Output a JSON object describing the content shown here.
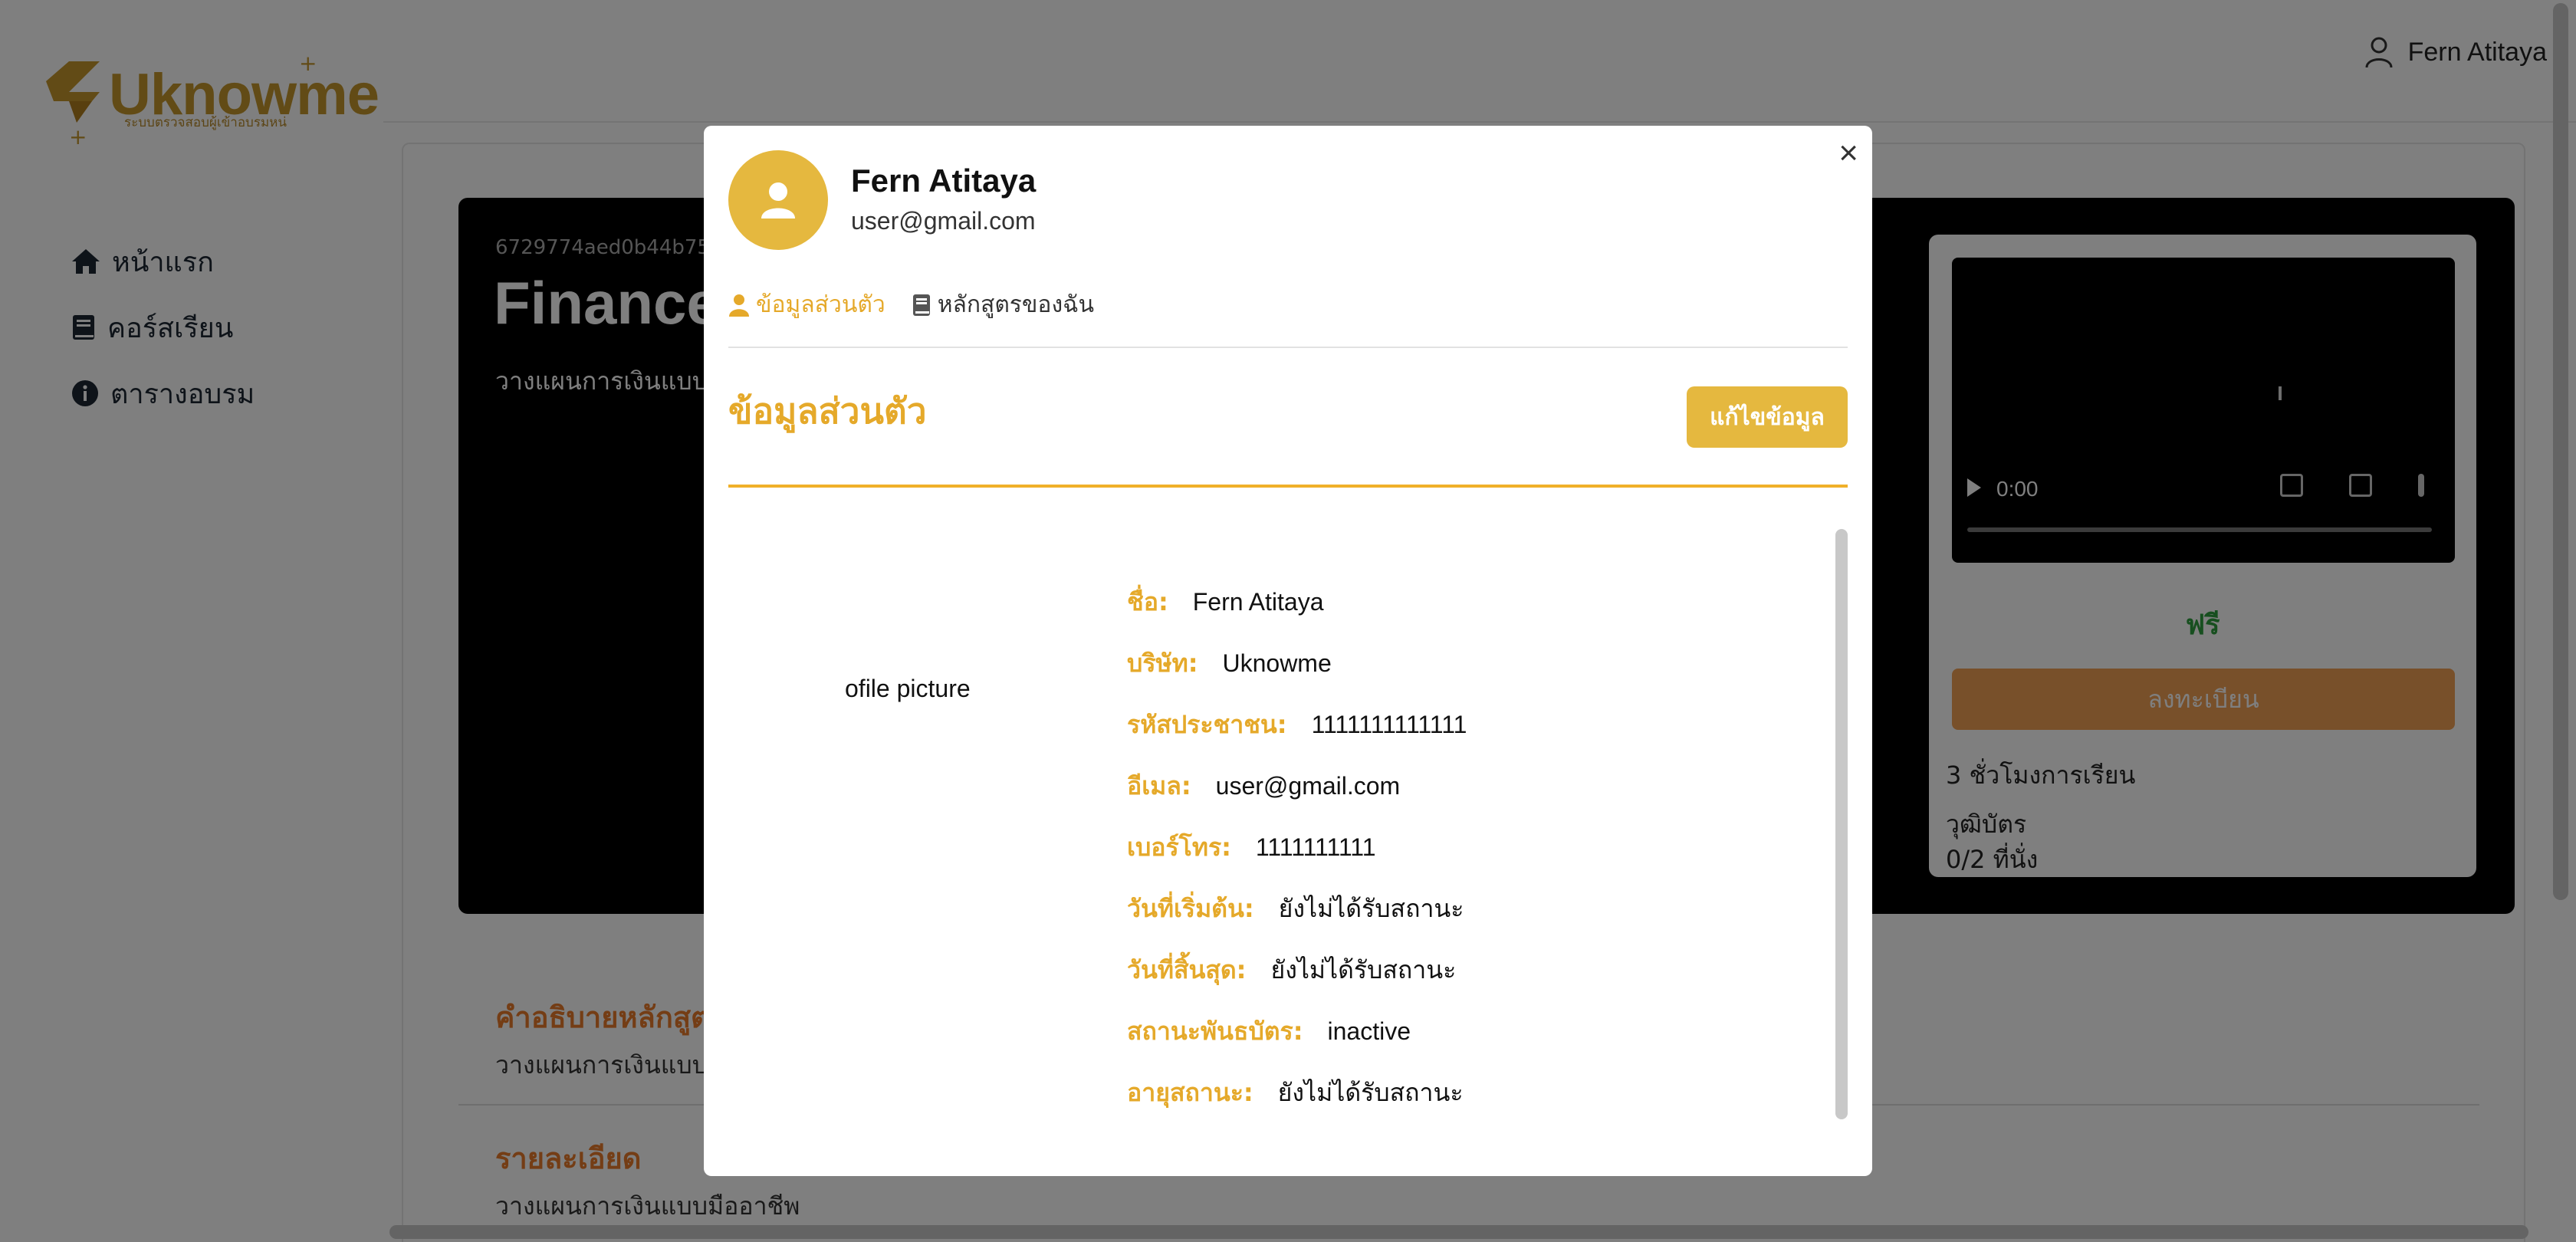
{
  "app": {
    "logo_text": "Uknowme",
    "logo_subtitle": "ระบบตรวจสอบผู้เข้าอบรมหน่"
  },
  "sidebar": {
    "items": [
      {
        "label": "หน้าแรก",
        "icon": "home-icon"
      },
      {
        "label": "คอร์สเรียน",
        "icon": "book-icon"
      },
      {
        "label": "ตารางอบรม",
        "icon": "info-icon"
      }
    ]
  },
  "header": {
    "user_name": "Fern Atitaya"
  },
  "course": {
    "id": "6729774aed0b44b753",
    "title": "Finance",
    "short_desc": "วางแผนการเงินแบบมื",
    "video_time": "0:00",
    "price": "ฟรี",
    "enroll_label": "ลงทะเบียน",
    "hours_text": "3 ชั่วโมงการเรียน",
    "certificate_text": "วุฒิบัตร",
    "seats_text": "0/2 ที่นั่ง",
    "desc_heading": "คำอธิบายหลักสูต",
    "desc_text": "วางแผนการเงินแบบมื",
    "detail_heading": "รายละเอียด",
    "detail_text": "วางแผนการเงินแบบมืออาชีพ"
  },
  "modal": {
    "name": "Fern Atitaya",
    "email": "user@gmail.com",
    "tabs": [
      {
        "label": "ข้อมูลส่วนตัว",
        "icon": "user-icon",
        "active": true
      },
      {
        "label": "หลักสูตรของฉัน",
        "icon": "book-icon",
        "active": false
      }
    ],
    "section_title": "ข้อมูลส่วนตัว",
    "edit_label": "แก้ไขข้อมูล",
    "close_label": "×",
    "picture_alt": "ofile picture",
    "fields": [
      {
        "label": "ชื่อ:",
        "value": "Fern Atitaya"
      },
      {
        "label": "บริษัท:",
        "value": "Uknowme"
      },
      {
        "label": "รหัสประชาชน:",
        "value": "1111111111111"
      },
      {
        "label": "อีเมล:",
        "value": "user@gmail.com"
      },
      {
        "label": "เบอร์โทร:",
        "value": "1111111111"
      },
      {
        "label": "วันที่เริ่มต้น:",
        "value": "ยังไม่ได้รับสถานะ"
      },
      {
        "label": "วันที่สิ้นสุด:",
        "value": "ยังไม่ได้รับสถานะ"
      },
      {
        "label": "สถานะพันธบัตร:",
        "value": "inactive"
      },
      {
        "label": "อายุสถานะ:",
        "value": "ยังไม่ได้รับสถานะ"
      }
    ]
  },
  "colors": {
    "accent_gold": "#e5b83f",
    "accent_orange": "#e87a2a",
    "price_green": "#2e9e3e"
  }
}
